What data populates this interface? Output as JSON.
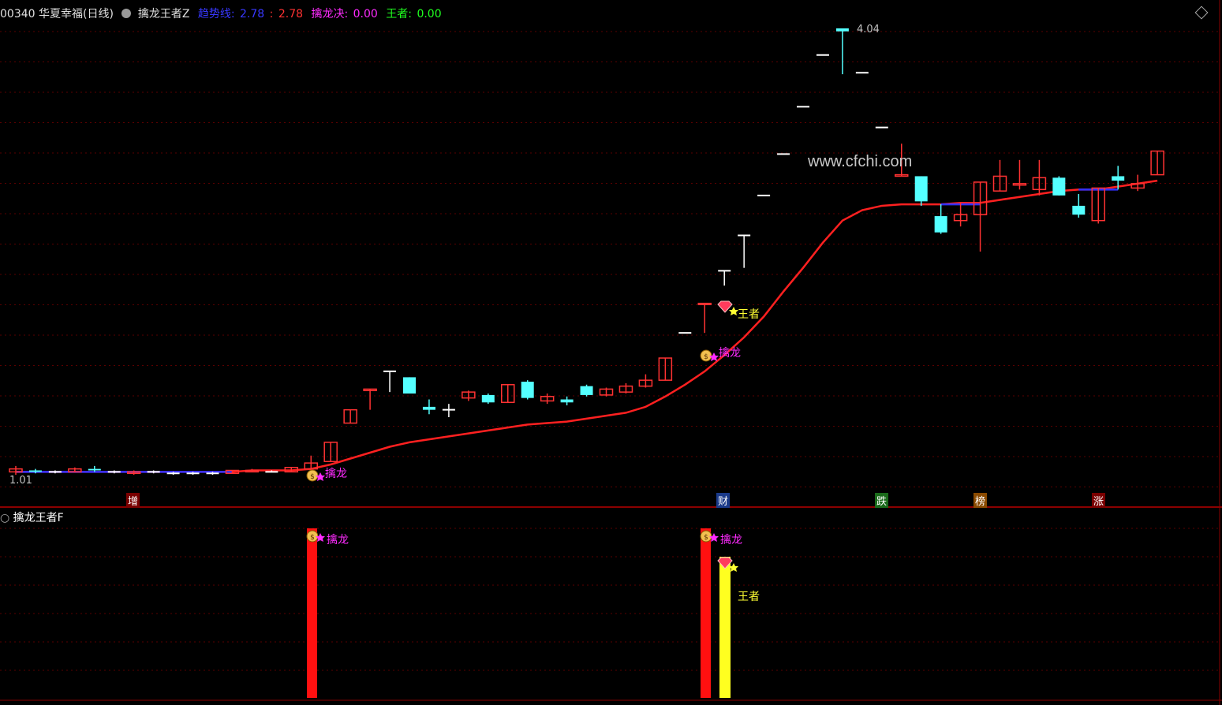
{
  "header": {
    "code_name": "00340 华夏幸福(日线)",
    "indicator_name": "擒龙王者Z",
    "trend_label": "趋势线:",
    "trend_value1": "2.78",
    "trend_sep": ":",
    "trend_value2": "2.78",
    "qinlong_label": "擒龙决:",
    "qinlong_value": "0.00",
    "wangzhe_label": "王者:",
    "wangzhe_value": "0.00"
  },
  "price_labels": {
    "high": "4.04",
    "low": "1.01"
  },
  "signals": {
    "qinlong": "擒龙",
    "wangzhe": "王者"
  },
  "bottom_tags": [
    "增",
    "财",
    "跌",
    "榜",
    "涨"
  ],
  "watermark": "www.cfchi.com",
  "sub_panel": {
    "title": "擒龙王者F"
  },
  "colors": {
    "up": "#ff3232",
    "down": "#54ffff",
    "trend": "#ff2020",
    "trend_flat": "#3030ff",
    "signal_red": "#ff1010",
    "signal_yellow": "#ffff20"
  },
  "chart_data": {
    "type": "candlestick",
    "y_high": 4.04,
    "y_low": 1.01,
    "candles": [
      {
        "o": 1.04,
        "c": 1.06,
        "h": 1.08,
        "l": 1.02,
        "dir": "up"
      },
      {
        "o": 1.05,
        "c": 1.04,
        "h": 1.06,
        "l": 1.03,
        "dir": "down"
      },
      {
        "o": 1.04,
        "c": 1.04,
        "h": 1.05,
        "l": 1.03,
        "dir": "flat"
      },
      {
        "o": 1.04,
        "c": 1.06,
        "h": 1.07,
        "l": 1.04,
        "dir": "up"
      },
      {
        "o": 1.06,
        "c": 1.05,
        "h": 1.08,
        "l": 1.04,
        "dir": "down"
      },
      {
        "o": 1.04,
        "c": 1.04,
        "h": 1.05,
        "l": 1.03,
        "dir": "flat"
      },
      {
        "o": 1.03,
        "c": 1.04,
        "h": 1.05,
        "l": 1.02,
        "dir": "up"
      },
      {
        "o": 1.04,
        "c": 1.04,
        "h": 1.05,
        "l": 1.03,
        "dir": "flat"
      },
      {
        "o": 1.03,
        "c": 1.03,
        "h": 1.04,
        "l": 1.02,
        "dir": "flat"
      },
      {
        "o": 1.03,
        "c": 1.03,
        "h": 1.04,
        "l": 1.02,
        "dir": "flat"
      },
      {
        "o": 1.03,
        "c": 1.03,
        "h": 1.04,
        "l": 1.02,
        "dir": "flat"
      },
      {
        "o": 1.03,
        "c": 1.05,
        "h": 1.05,
        "l": 1.03,
        "dir": "up"
      },
      {
        "o": 1.04,
        "c": 1.05,
        "h": 1.06,
        "l": 1.04,
        "dir": "up"
      },
      {
        "o": 1.04,
        "c": 1.04,
        "h": 1.05,
        "l": 1.04,
        "dir": "flat"
      },
      {
        "o": 1.04,
        "c": 1.07,
        "h": 1.07,
        "l": 1.04,
        "dir": "up"
      },
      {
        "o": 1.06,
        "c": 1.1,
        "h": 1.15,
        "l": 1.05,
        "dir": "up"
      },
      {
        "o": 1.11,
        "c": 1.24,
        "h": 1.24,
        "l": 1.11,
        "dir": "up"
      },
      {
        "o": 1.37,
        "c": 1.46,
        "h": 1.46,
        "l": 1.37,
        "dir": "up"
      },
      {
        "o": 1.59,
        "c": 1.6,
        "h": 1.6,
        "l": 1.46,
        "dir": "up"
      },
      {
        "o": 1.71,
        "c": 1.72,
        "h": 1.72,
        "l": 1.58,
        "dir": "flat_w"
      },
      {
        "o": 1.68,
        "c": 1.57,
        "h": 1.68,
        "l": 1.57,
        "dir": "down"
      },
      {
        "o": 1.48,
        "c": 1.46,
        "h": 1.53,
        "l": 1.43,
        "dir": "down_cross"
      },
      {
        "o": 1.46,
        "c": 1.46,
        "h": 1.5,
        "l": 1.41,
        "dir": "flat_w"
      },
      {
        "o": 1.54,
        "c": 1.58,
        "h": 1.59,
        "l": 1.52,
        "dir": "up"
      },
      {
        "o": 1.56,
        "c": 1.51,
        "h": 1.57,
        "l": 1.5,
        "dir": "down"
      },
      {
        "o": 1.51,
        "c": 1.63,
        "h": 1.63,
        "l": 1.51,
        "dir": "up"
      },
      {
        "o": 1.65,
        "c": 1.54,
        "h": 1.66,
        "l": 1.53,
        "dir": "down"
      },
      {
        "o": 1.52,
        "c": 1.55,
        "h": 1.57,
        "l": 1.5,
        "dir": "up"
      },
      {
        "o": 1.53,
        "c": 1.51,
        "h": 1.55,
        "l": 1.49,
        "dir": "down"
      },
      {
        "o": 1.62,
        "c": 1.56,
        "h": 1.63,
        "l": 1.55,
        "dir": "down"
      },
      {
        "o": 1.56,
        "c": 1.6,
        "h": 1.61,
        "l": 1.55,
        "dir": "up"
      },
      {
        "o": 1.58,
        "c": 1.62,
        "h": 1.64,
        "l": 1.57,
        "dir": "up"
      },
      {
        "o": 1.62,
        "c": 1.66,
        "h": 1.7,
        "l": 1.61,
        "dir": "up"
      },
      {
        "o": 1.66,
        "c": 1.81,
        "h": 1.81,
        "l": 1.66,
        "dir": "up"
      },
      {
        "o": 1.98,
        "c": 1.98,
        "h": 1.98,
        "l": 1.98,
        "dir": "flat_w"
      },
      {
        "o": 2.18,
        "c": 2.18,
        "h": 2.18,
        "l": 1.98,
        "dir": "up"
      },
      {
        "o": 2.4,
        "c": 2.4,
        "h": 2.4,
        "l": 2.3,
        "dir": "flat_w"
      },
      {
        "o": 2.64,
        "c": 2.64,
        "h": 2.64,
        "l": 2.42,
        "dir": "flat_w"
      },
      {
        "o": 2.91,
        "c": 2.91,
        "h": 2.91,
        "l": 2.91,
        "dir": "flat_w"
      },
      {
        "o": 3.19,
        "c": 3.19,
        "h": 3.19,
        "l": 3.19,
        "dir": "flat_w"
      },
      {
        "o": 3.51,
        "c": 3.51,
        "h": 3.51,
        "l": 3.51,
        "dir": "flat_w"
      },
      {
        "o": 3.86,
        "c": 3.86,
        "h": 3.86,
        "l": 3.86,
        "dir": "flat_w"
      },
      {
        "o": 4.04,
        "c": 4.02,
        "h": 4.04,
        "l": 3.73,
        "dir": "down"
      },
      {
        "o": 3.74,
        "c": 3.74,
        "h": 3.74,
        "l": 3.74,
        "dir": "flat_w"
      },
      {
        "o": 3.37,
        "c": 3.37,
        "h": 3.37,
        "l": 3.37,
        "dir": "flat_w"
      },
      {
        "o": 3.04,
        "c": 3.05,
        "h": 3.26,
        "l": 3.04,
        "dir": "up"
      },
      {
        "o": 3.04,
        "c": 2.87,
        "h": 3.04,
        "l": 2.84,
        "dir": "down"
      },
      {
        "o": 2.77,
        "c": 2.66,
        "h": 2.85,
        "l": 2.65,
        "dir": "down"
      },
      {
        "o": 2.74,
        "c": 2.78,
        "h": 2.86,
        "l": 2.7,
        "dir": "up"
      },
      {
        "o": 2.78,
        "c": 3.0,
        "h": 3.0,
        "l": 2.53,
        "dir": "up"
      },
      {
        "o": 2.94,
        "c": 3.04,
        "h": 3.15,
        "l": 2.94,
        "dir": "up"
      },
      {
        "o": 2.98,
        "c": 2.99,
        "h": 3.15,
        "l": 2.95,
        "dir": "up"
      },
      {
        "o": 2.95,
        "c": 3.03,
        "h": 3.15,
        "l": 2.91,
        "dir": "up"
      },
      {
        "o": 3.03,
        "c": 2.91,
        "h": 3.04,
        "l": 2.91,
        "dir": "down"
      },
      {
        "o": 2.84,
        "c": 2.78,
        "h": 2.92,
        "l": 2.76,
        "dir": "down"
      },
      {
        "o": 2.74,
        "c": 2.96,
        "h": 2.96,
        "l": 2.72,
        "dir": "up"
      },
      {
        "o": 3.01,
        "c": 3.04,
        "h": 3.11,
        "l": 2.95,
        "dir": "down"
      },
      {
        "o": 2.96,
        "c": 2.99,
        "h": 3.05,
        "l": 2.94,
        "dir": "up"
      },
      {
        "o": 3.05,
        "c": 3.21,
        "h": 3.21,
        "l": 3.05,
        "dir": "up"
      }
    ],
    "trend": [
      1.04,
      1.04,
      1.04,
      1.04,
      1.04,
      1.04,
      1.04,
      1.04,
      1.04,
      1.04,
      1.04,
      1.04,
      1.05,
      1.05,
      1.05,
      1.06,
      1.09,
      1.13,
      1.17,
      1.21,
      1.24,
      1.26,
      1.28,
      1.3,
      1.32,
      1.34,
      1.36,
      1.37,
      1.38,
      1.4,
      1.42,
      1.44,
      1.48,
      1.55,
      1.63,
      1.72,
      1.83,
      1.95,
      2.09,
      2.26,
      2.42,
      2.59,
      2.74,
      2.81,
      2.84,
      2.85,
      2.85,
      2.85,
      2.86,
      2.86,
      2.88,
      2.9,
      2.92,
      2.94,
      2.95,
      2.95,
      2.97,
      2.99,
      3.01
    ]
  }
}
